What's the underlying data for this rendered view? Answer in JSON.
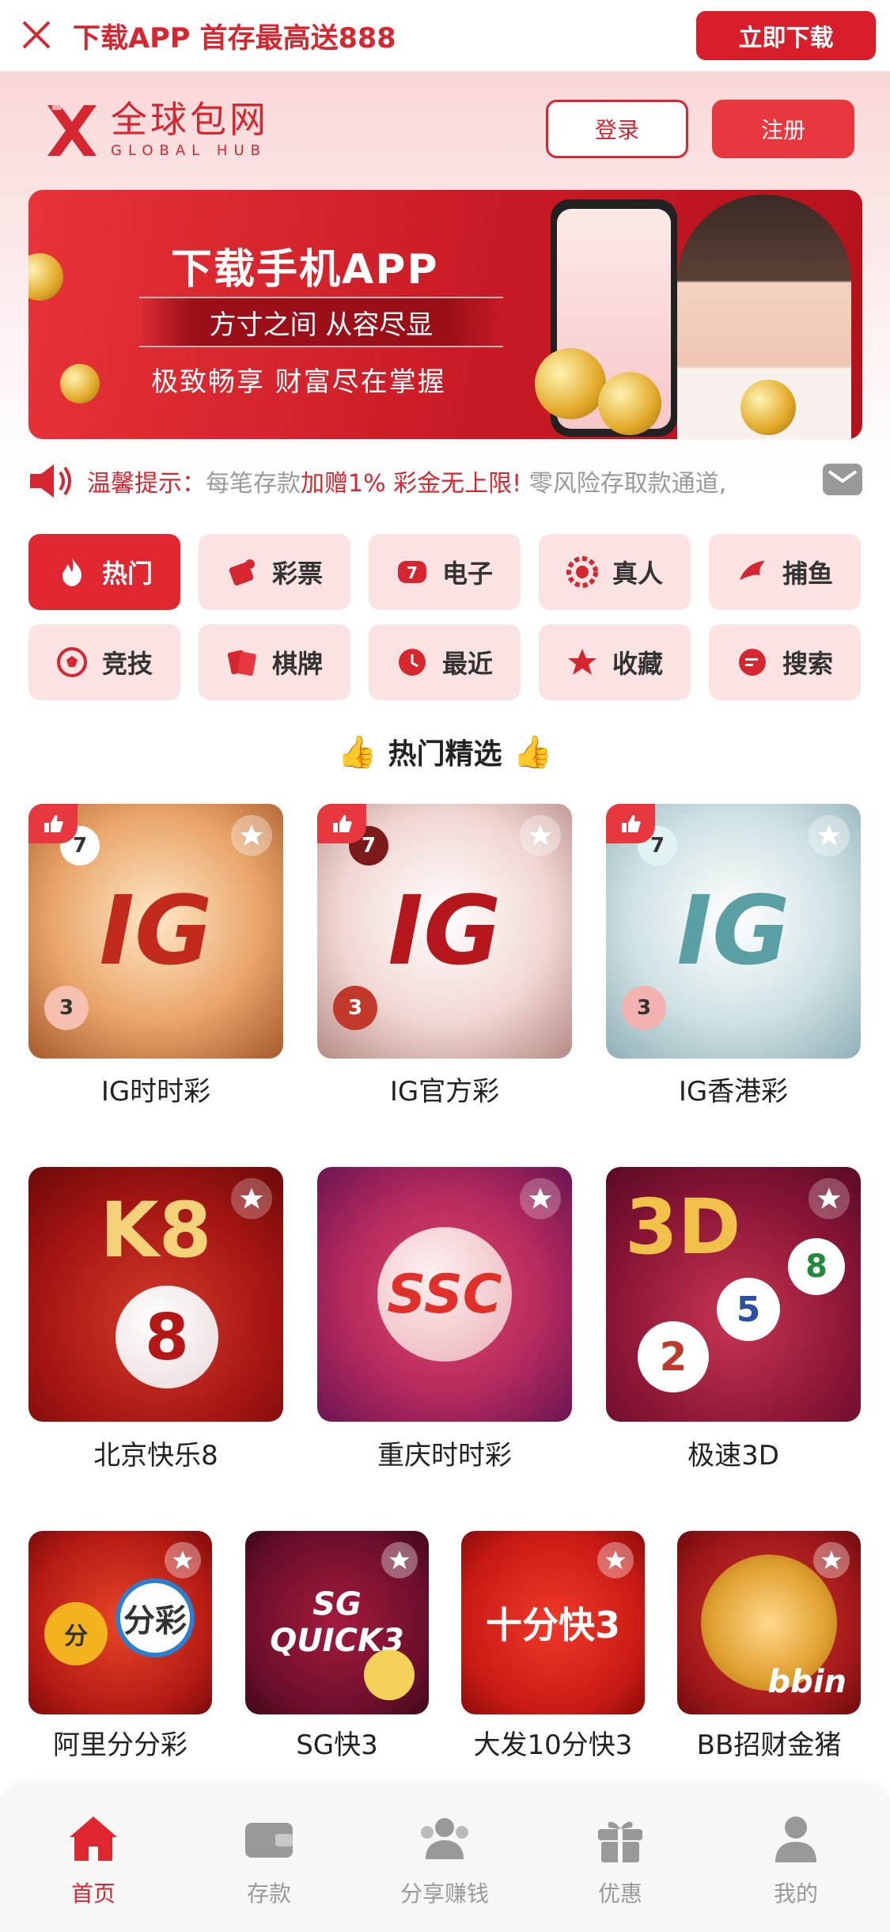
{
  "topbar": {
    "promo": "下载APP 首存最高送888",
    "download_btn": "立即下载"
  },
  "header": {
    "logo_cn": "全球包网",
    "logo_en": "GLOBAL HUB",
    "login_btn": "登录",
    "register_btn": "注册"
  },
  "banner": {
    "title": "下载手机APP",
    "subtitle": "方寸之间 从容尽显",
    "tagline": "极致畅享 财富尽在掌握"
  },
  "notice": {
    "label": "温馨提示：",
    "text_pre": "每笔存款",
    "text_hl": "加赠1% 彩金无上限!",
    "text_post": " 零风险存取款通道,"
  },
  "categories": [
    {
      "label": "热门",
      "icon": "flame-icon"
    },
    {
      "label": "彩票",
      "icon": "lottery-icon"
    },
    {
      "label": "电子",
      "icon": "slot-icon"
    },
    {
      "label": "真人",
      "icon": "chip-icon"
    },
    {
      "label": "捕鱼",
      "icon": "fish-icon"
    },
    {
      "label": "竞技",
      "icon": "soccer-icon"
    },
    {
      "label": "棋牌",
      "icon": "cards-icon"
    },
    {
      "label": "最近",
      "icon": "clock-icon"
    },
    {
      "label": "收藏",
      "icon": "star-icon"
    },
    {
      "label": "搜索",
      "icon": "search-icon"
    }
  ],
  "section": {
    "title": "热门精选"
  },
  "games_row1": [
    {
      "name": "IG时时彩",
      "logo": "IG"
    },
    {
      "name": "IG官方彩",
      "logo": "IG"
    },
    {
      "name": "IG香港彩",
      "logo": "IG"
    }
  ],
  "games_row2": [
    {
      "name": "北京快乐8",
      "logo": "K8"
    },
    {
      "name": "重庆时时彩",
      "logo": "SSC"
    },
    {
      "name": "极速3D",
      "logo": "3D"
    }
  ],
  "games_row3": [
    {
      "name": "阿里分分彩",
      "logo": "分彩"
    },
    {
      "name": "SG快3",
      "logo": "SG QUICK3"
    },
    {
      "name": "大发10分快3",
      "logo": "十分快3"
    },
    {
      "name": "BB招财金猪",
      "logo": "bbin"
    }
  ],
  "bottom_nav": [
    {
      "label": "首页",
      "icon": "home-icon"
    },
    {
      "label": "存款",
      "icon": "wallet-icon"
    },
    {
      "label": "分享赚钱",
      "icon": "users-icon"
    },
    {
      "label": "优惠",
      "icon": "gift-icon"
    },
    {
      "label": "我的",
      "icon": "user-icon"
    }
  ],
  "colors": {
    "brand": "#d6262f",
    "pink": "#fbe3e4",
    "muted": "#999999"
  }
}
